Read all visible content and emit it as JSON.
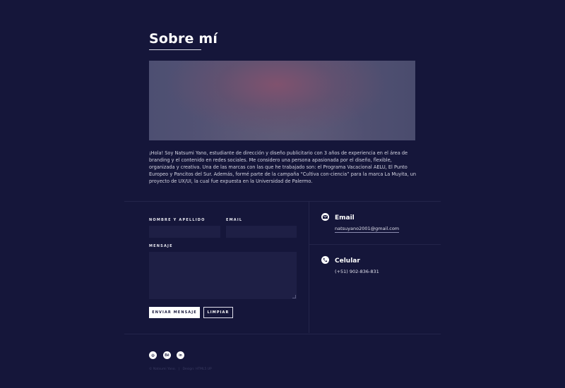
{
  "about": {
    "title": "Sobre mí",
    "paragraph": "¡Hola! Soy Natsumi Yano, estudiante de dirección y diseño publicitario con 3 años de experiencia en el área de branding y el contenido en redes sociales. Me considero una persona apasionada por el diseño, flexible, organizada y creativa. Una de las marcas con las que he trabajado son: el Programa Vacacional AELU, El Punto Europeo y Pancitos del Sur. Además, formé parte de la campaña “Cultiva con-ciencia” para la marca La Muyita, un proyecto de UX/UI, la cual fue expuesta en la Universidad de Palermo."
  },
  "form": {
    "name_label": "NOMBRE Y APELLIDO",
    "email_label": "EMAIL",
    "message_label": "MENSAJE",
    "send_button": "ENVIAR MENSAJE",
    "clear_button": "LIMPIAR"
  },
  "contact": {
    "email_title": "Email",
    "email_value": "natsuyano2001@gmail.com",
    "phone_title": "Celular",
    "phone_value": "(+51) 902-836-831"
  },
  "footer": {
    "social": [
      {
        "icon": "dribbble-icon",
        "glyph": "◎"
      },
      {
        "icon": "behance-icon",
        "glyph": "Bē"
      },
      {
        "icon": "linkedin-icon",
        "glyph": "in"
      }
    ],
    "copyright": "© Natsumi Yano.",
    "design_credit": "Design: HTML5 UP"
  },
  "colors": {
    "background": "#15163a",
    "field": "#1e1f45",
    "divider": "#24254a",
    "text": "#ffffff"
  }
}
